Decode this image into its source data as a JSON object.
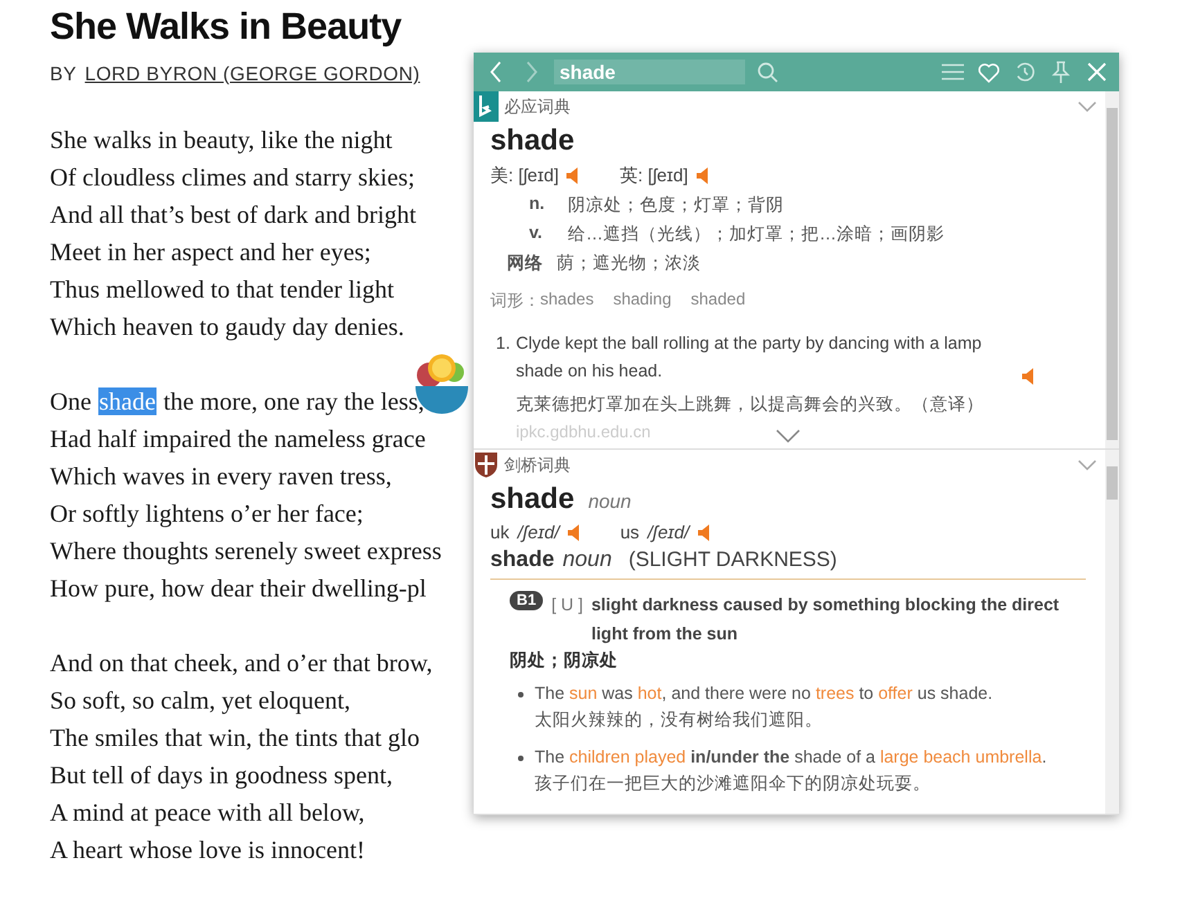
{
  "poem": {
    "title": "She Walks in Beauty",
    "byline_prefix": "BY",
    "author": "LORD BYRON (GEORGE GORDON)",
    "stanzas": [
      {
        "lines": [
          {
            "text": "She walks in beauty, like the night"
          },
          {
            "text": "Of cloudless climes and starry skies;"
          },
          {
            "text": "And all that’s best of dark and bright"
          },
          {
            "text": "Meet in her aspect and her eyes;"
          },
          {
            "text": "Thus mellowed to that tender light"
          },
          {
            "text": "Which heaven to gaudy day denies."
          }
        ]
      },
      {
        "lines": [
          {
            "text": "One ",
            "selection": "shade",
            "after": " the more, one ray the less,"
          },
          {
            "text": "Had half impaired the nameless grace"
          },
          {
            "text": "Which waves in every raven tress,"
          },
          {
            "text": "Or softly lightens o’er her face;"
          },
          {
            "text": "Where thoughts serenely sweet express"
          },
          {
            "text": "How pure, how dear their dwelling-pl"
          }
        ]
      },
      {
        "lines": [
          {
            "text": "And on that cheek, and o’er that brow,"
          },
          {
            "text": "So soft, so calm, yet eloquent,"
          },
          {
            "text": "The smiles that win, the tints that glo"
          },
          {
            "text": "But tell of days in goodness spent,"
          },
          {
            "text": "A mind at peace with all below,"
          },
          {
            "text": "A heart whose love is innocent!"
          }
        ]
      }
    ]
  },
  "popup": {
    "search": {
      "value": "shade"
    },
    "back_disabled": false,
    "forward_disabled": true,
    "bing": {
      "source": "必应词典",
      "expanded": true,
      "headword": "shade",
      "pronunciations": [
        {
          "label": "美:",
          "ipa": "[ʃeɪd]"
        },
        {
          "label": "英:",
          "ipa": "[ʃeɪd]"
        }
      ],
      "senses": [
        {
          "pos": "n.",
          "kind": "pos",
          "meaning": "阴凉处；色度；灯罩；背阴"
        },
        {
          "pos": "v.",
          "kind": "pos",
          "meaning": "给…遮挡（光线）；加灯罩；把…涂暗；画阴影"
        },
        {
          "pos": "网络",
          "kind": "web",
          "meaning": "荫；遮光物；浓淡"
        }
      ],
      "forms_label": "词形：",
      "forms": [
        "shades",
        "shading",
        "shaded"
      ],
      "examples": [
        {
          "number": "1.",
          "en": "Clyde kept the ball rolling at the party by dancing with a lamp shade on his head.",
          "zh": "克莱德把灯罩加在头上跳舞，以提高舞会的兴致。（意译）",
          "source": "ipkc.gdbhu.edu.cn"
        }
      ]
    },
    "cambridge": {
      "source": "剑桥词典",
      "expanded": true,
      "headword": "shade",
      "pos": "noun",
      "pronunciations": [
        {
          "label": "uk",
          "ipa": "/ʃeɪd/"
        },
        {
          "label": "us",
          "ipa": "/ʃeɪd/"
        }
      ],
      "sense_head": {
        "word": "shade",
        "pos": "noun",
        "guide": "(SLIGHT DARKNESS)"
      },
      "level": "B1",
      "grammar": "[ U ]",
      "definition": "slight darkness caused by something blocking the direct light from the sun",
      "translation": "阴处；阴凉处",
      "examples": [
        {
          "segments": [
            {
              "kind": "plain",
              "text": "The "
            },
            {
              "kind": "keyword",
              "text": "sun"
            },
            {
              "kind": "plain",
              "text": " was "
            },
            {
              "kind": "keyword",
              "text": "hot"
            },
            {
              "kind": "plain",
              "text": ", and there were no "
            },
            {
              "kind": "keyword",
              "text": "trees"
            },
            {
              "kind": "plain",
              "text": " to "
            },
            {
              "kind": "keyword",
              "text": "offer"
            },
            {
              "kind": "plain",
              "text": " us shade."
            }
          ],
          "zh": "太阳火辣辣的，没有树给我们遮阳。"
        },
        {
          "segments": [
            {
              "kind": "plain",
              "text": "The "
            },
            {
              "kind": "keyword",
              "text": "children played"
            },
            {
              "kind": "bold",
              "text": " in/under the"
            },
            {
              "kind": "plain",
              "text": " shade of a "
            },
            {
              "kind": "keyword",
              "text": "large beach umbrella"
            },
            {
              "kind": "plain",
              "text": "."
            }
          ],
          "zh": "孩子们在一把巨大的沙滩遮阳伞下的阴凉处玩耍。"
        }
      ]
    }
  }
}
